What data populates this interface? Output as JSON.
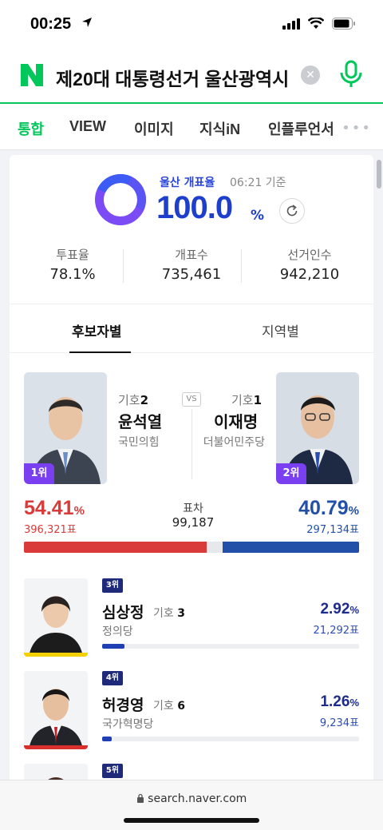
{
  "status": {
    "time": "00:25"
  },
  "search": {
    "query": "제20대 대통령선거 울산광역시"
  },
  "tabs": [
    {
      "label": "통합",
      "active": true
    },
    {
      "label": "VIEW"
    },
    {
      "label": "이미지"
    },
    {
      "label": "지식iN"
    },
    {
      "label": "인플루언서"
    }
  ],
  "count": {
    "label": "울산 개표율",
    "time": "06:21 기준",
    "value": "100.0",
    "unit": "%"
  },
  "stats": [
    {
      "label": "투표율",
      "value": "78.1%"
    },
    {
      "label": "개표수",
      "value": "735,461"
    },
    {
      "label": "선거인수",
      "value": "942,210"
    }
  ],
  "sub_tabs": [
    {
      "label": "후보자별",
      "active": true
    },
    {
      "label": "지역별"
    }
  ],
  "main": {
    "vs": "VS",
    "diff_label": "표차",
    "diff_value": "99,187",
    "left": {
      "number_label": "기호",
      "number": "2",
      "name": "윤석열",
      "party": "국민의힘",
      "rank": "1위",
      "pct": "54.41",
      "unit": "%",
      "votes": "396,321표",
      "color": "#d93a3a",
      "share": 54.41
    },
    "right": {
      "number_label": "기호",
      "number": "1",
      "name": "이재명",
      "party": "더불어민주당",
      "rank": "2위",
      "pct": "40.79",
      "unit": "%",
      "votes": "297,134표",
      "color": "#2250a8",
      "share": 40.79
    }
  },
  "minor": [
    {
      "rank": "3위",
      "name": "심상정",
      "number_label": "기호",
      "number": "3",
      "party": "정의당",
      "pct": "2.92",
      "unit": "%",
      "votes": "21,292표",
      "share": 2.92
    },
    {
      "rank": "4위",
      "name": "허경영",
      "number_label": "기호",
      "number": "6",
      "party": "국가혁명당",
      "pct": "1.26",
      "unit": "%",
      "votes": "9,234표",
      "share": 1.26
    },
    {
      "rank": "5위"
    }
  ],
  "browser": {
    "url": "search.naver.com"
  }
}
